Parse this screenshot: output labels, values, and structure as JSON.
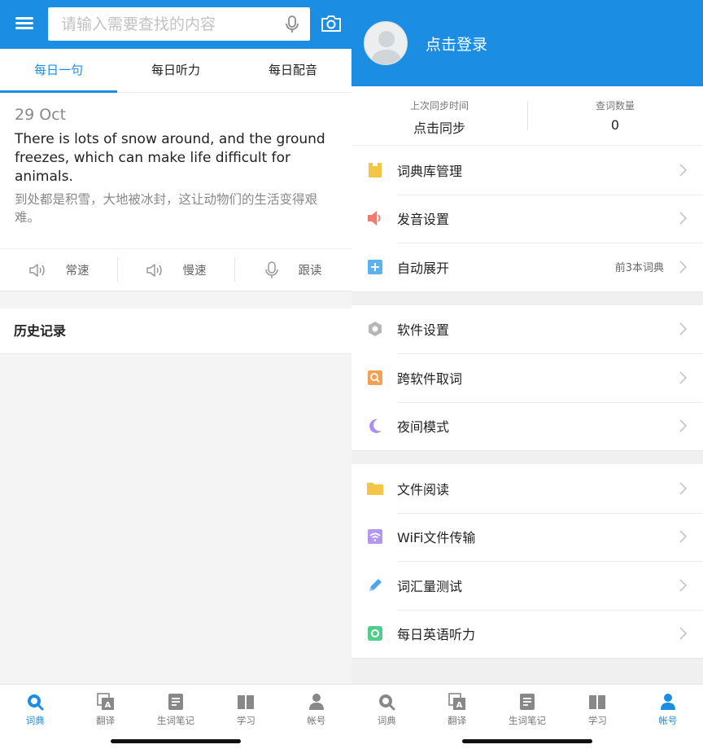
{
  "left": {
    "search": {
      "placeholder": "请输入需要查找的内容"
    },
    "tabs": [
      {
        "label": "每日一句"
      },
      {
        "label": "每日听力"
      },
      {
        "label": "每日配音"
      }
    ],
    "daily": {
      "date": "29 Oct",
      "sentence_en": "There is lots of snow around, and the ground freezes, which can make life difficult for animals.",
      "sentence_zh": "到处都是积雪，大地被冰封，这让动物们的生活变得艰难。"
    },
    "audio_buttons": [
      {
        "label": "常速",
        "icon": "speaker-icon"
      },
      {
        "label": "慢速",
        "icon": "speaker-icon"
      },
      {
        "label": "跟读",
        "icon": "mic-icon"
      }
    ],
    "history_title": "历史记录"
  },
  "right": {
    "login_text": "点击登录",
    "sync": [
      {
        "label": "上次同步时间",
        "value": "点击同步"
      },
      {
        "label": "查词数量",
        "value": "0"
      }
    ],
    "groups": [
      [
        {
          "label": "词典库管理",
          "icon": "dictionary-icon",
          "color": "#f5c645",
          "extra": ""
        },
        {
          "label": "发音设置",
          "icon": "speaker-icon",
          "color": "#f07a6e",
          "extra": ""
        },
        {
          "label": "自动展开",
          "icon": "plus-square-icon",
          "color": "#5bb2ee",
          "extra": "前3本词典"
        }
      ],
      [
        {
          "label": "软件设置",
          "icon": "gear-icon",
          "color": "#b6b6b6",
          "extra": ""
        },
        {
          "label": "跨软件取词",
          "icon": "search-square-icon",
          "color": "#f4a054",
          "extra": ""
        },
        {
          "label": "夜间模式",
          "icon": "moon-icon",
          "color": "#a890ee",
          "extra": ""
        }
      ],
      [
        {
          "label": "文件阅读",
          "icon": "folder-icon",
          "color": "#f5c645",
          "extra": ""
        },
        {
          "label": "WiFi文件传输",
          "icon": "wifi-icon",
          "color": "#b397f0",
          "extra": ""
        },
        {
          "label": "词汇量测试",
          "icon": "pen-icon",
          "color": "#4ba6ec",
          "extra": ""
        },
        {
          "label": "每日英语听力",
          "icon": "radio-icon",
          "color": "#52cc8e",
          "extra": ""
        }
      ]
    ]
  },
  "bottom_nav": [
    {
      "label": "词典",
      "icon": "dictionary-search-icon"
    },
    {
      "label": "翻译",
      "icon": "translate-icon"
    },
    {
      "label": "生词笔记",
      "icon": "notes-icon"
    },
    {
      "label": "学习",
      "icon": "book-icon"
    },
    {
      "label": "帐号",
      "icon": "account-icon"
    }
  ],
  "colors": {
    "primary": "#1b8ee3",
    "inactive": "#777777"
  }
}
